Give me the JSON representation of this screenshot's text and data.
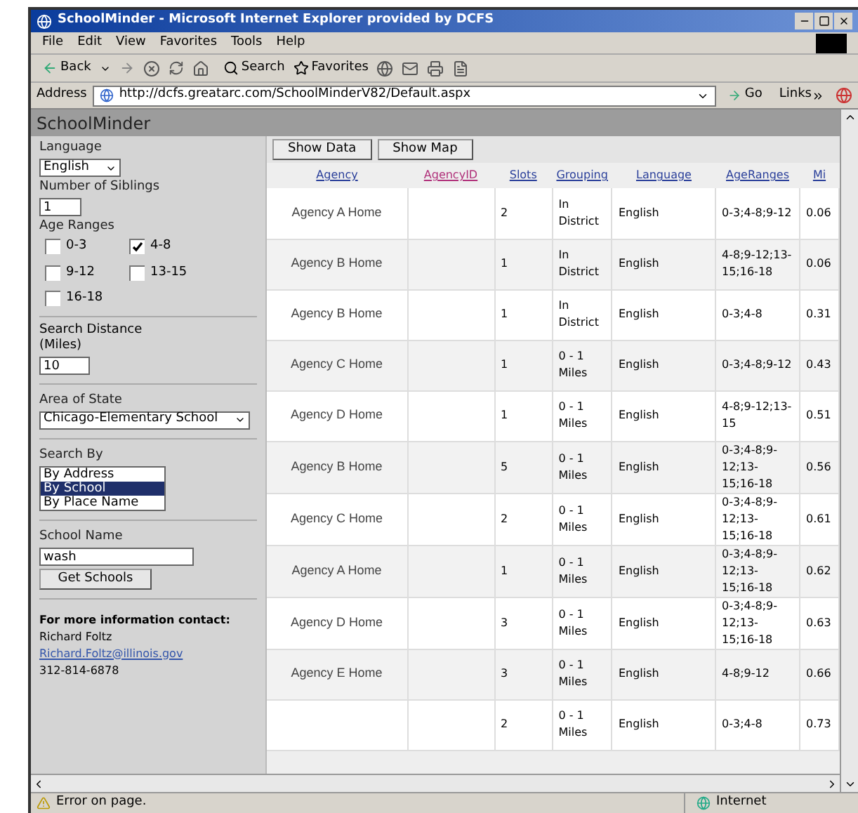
{
  "window": {
    "title": "SchoolMinder - Microsoft Internet Explorer provided by DCFS"
  },
  "menu": [
    "File",
    "Edit",
    "View",
    "Favorites",
    "Tools",
    "Help"
  ],
  "toolbar": {
    "back": "Back",
    "search": "Search",
    "favorites": "Favorites"
  },
  "address": {
    "label": "Address",
    "value": "http://dcfs.greatarc.com/SchoolMinderV82/Default.aspx",
    "go": "Go",
    "links": "Links"
  },
  "app": {
    "title": "SchoolMinder"
  },
  "sidebar": {
    "language": {
      "label": "Language",
      "value": "English"
    },
    "siblings": {
      "label": "Number of Siblings",
      "value": "1"
    },
    "age_ranges": {
      "label": "Age Ranges",
      "options": [
        {
          "label": "0-3",
          "checked": false
        },
        {
          "label": "4-8",
          "checked": true
        },
        {
          "label": "9-12",
          "checked": false
        },
        {
          "label": "13-15",
          "checked": false
        },
        {
          "label": "16-18",
          "checked": false
        }
      ]
    },
    "distance": {
      "label": "Search Distance (Miles)",
      "value": "10"
    },
    "area": {
      "label": "Area of State",
      "value": "Chicago-Elementary School"
    },
    "search_by": {
      "label": "Search By",
      "options": [
        {
          "label": "By Address",
          "selected": false
        },
        {
          "label": "By School",
          "selected": true
        },
        {
          "label": "By Place Name",
          "selected": false
        }
      ]
    },
    "school_name": {
      "label": "School Name",
      "value": "wash"
    },
    "get_button": "Get Schools",
    "contact": {
      "heading": "For more information contact:",
      "name": "Richard Foltz",
      "email": "Richard.Foltz@illinois.gov",
      "phone": "312-814-6878"
    }
  },
  "buttons": [
    "Show Data",
    "Show Map"
  ],
  "table": {
    "columns": [
      {
        "label": "Agency",
        "color": "#2a3f9a"
      },
      {
        "label": "AgencyID",
        "color": "#b0307a"
      },
      {
        "label": "Slots",
        "color": "#2a3f9a"
      },
      {
        "label": "Grouping",
        "color": "#2a3f9a"
      },
      {
        "label": "Language",
        "color": "#2a3f9a"
      },
      {
        "label": "AgeRanges",
        "color": "#2a3f9a"
      },
      {
        "label": "Mi",
        "color": "#2a3f9a"
      }
    ],
    "rows": [
      [
        "Agency A Home",
        "",
        "2",
        "In District",
        "English",
        "0-3;4-8;9-12",
        "0.06"
      ],
      [
        "Agency B Home",
        "",
        "1",
        "In District",
        "English",
        "4-8;9-12;13-15;16-18",
        "0.06"
      ],
      [
        "Agency B Home",
        "",
        "1",
        "In District",
        "English",
        "0-3;4-8",
        "0.31"
      ],
      [
        "Agency C Home",
        "",
        "1",
        "0 - 1 Miles",
        "English",
        "0-3;4-8;9-12",
        "0.43"
      ],
      [
        "Agency D Home",
        "",
        "1",
        "0 - 1 Miles",
        "English",
        "4-8;9-12;13-15",
        "0.51"
      ],
      [
        "Agency B Home",
        "",
        "5",
        "0 - 1 Miles",
        "English",
        "0-3;4-8;9-12;13-15;16-18",
        "0.56"
      ],
      [
        "Agency C Home",
        "",
        "2",
        "0 - 1 Miles",
        "English",
        "0-3;4-8;9-12;13-15;16-18",
        "0.61"
      ],
      [
        "Agency A Home",
        "",
        "1",
        "0 - 1 Miles",
        "English",
        "0-3;4-8;9-12;13-15;16-18",
        "0.62"
      ],
      [
        "Agency D Home",
        "",
        "3",
        "0 - 1 Miles",
        "English",
        "0-3;4-8;9-12;13-15;16-18",
        "0.63"
      ],
      [
        "Agency E Home",
        "",
        "3",
        "0 - 1 Miles",
        "English",
        "4-8;9-12",
        "0.66"
      ],
      [
        "",
        "",
        "2",
        "0 - 1 Miles",
        "English",
        "0-3;4-8",
        "0.73"
      ]
    ]
  },
  "status": {
    "text": "Error on page.",
    "zone": "Internet"
  }
}
